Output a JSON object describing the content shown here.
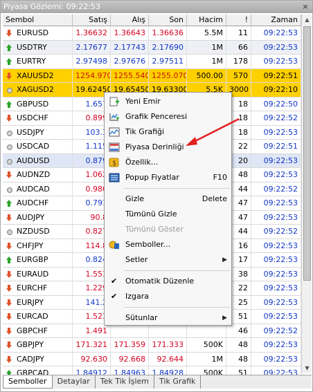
{
  "window": {
    "title": "Piyasa Gözlemi: 09:22:53",
    "close_label": "×"
  },
  "columns": {
    "symbol": "Sembol",
    "bid": "Satış",
    "ask": "Alış",
    "last": "Son",
    "volume": "Hacim",
    "exec": "!",
    "time": "Zaman"
  },
  "rows": [
    {
      "symbol": "EURUSD",
      "dir": "down",
      "bid": "1.36632",
      "ask": "1.36643",
      "last": "1.36636",
      "volume": "5.5M",
      "exec": "11",
      "time": "09:22:53",
      "color": "down",
      "bg": ""
    },
    {
      "symbol": "USDTRY",
      "dir": "up",
      "bid": "2.17677",
      "ask": "2.17743",
      "last": "2.17690",
      "volume": "1M",
      "exec": "66",
      "time": "09:22:53",
      "color": "up",
      "bg": "alt"
    },
    {
      "symbol": "EURTRY",
      "dir": "up",
      "bid": "2.97498",
      "ask": "2.97676",
      "last": "2.97511",
      "volume": "1M",
      "exec": "178",
      "time": "09:22:53",
      "color": "up",
      "bg": ""
    },
    {
      "symbol": "XAUUSD2",
      "dir": "down",
      "bid": "1254.970",
      "ask": "1255.540",
      "last": "1255.070",
      "volume": "500.00",
      "exec": "570",
      "time": "09:22:51",
      "color": "down",
      "bg": "gold"
    },
    {
      "symbol": "XAGUSD2",
      "dir": "dot",
      "bid": "19.62450",
      "ask": "19.65450",
      "last": "19.63300",
      "volume": "5.5K",
      "exec": "3000",
      "time": "09:22:10",
      "color": "none",
      "bg": "gold"
    },
    {
      "symbol": "GBPUSD",
      "dir": "up",
      "bid": "1.657",
      "ask": "",
      "last": "",
      "volume": "",
      "exec": "18",
      "time": "09:22:50",
      "color": "up",
      "bg": ""
    },
    {
      "symbol": "USDCHF",
      "dir": "down",
      "bid": "0.899",
      "ask": "",
      "last": "",
      "volume": "",
      "exec": "18",
      "time": "09:22:52",
      "color": "down",
      "bg": ""
    },
    {
      "symbol": "USDJPY",
      "dir": "dot",
      "bid": "103.3",
      "ask": "",
      "last": "",
      "volume": "",
      "exec": "18",
      "time": "09:22:53",
      "color": "up",
      "bg": ""
    },
    {
      "symbol": "USDCAD",
      "dir": "dot",
      "bid": "1.115",
      "ask": "",
      "last": "",
      "volume": "",
      "exec": "22",
      "time": "09:22:51",
      "color": "up",
      "bg": ""
    },
    {
      "symbol": "AUDUSD",
      "dir": "dot",
      "bid": "0.879",
      "ask": "",
      "last": "",
      "volume": "",
      "exec": "20",
      "time": "09:22:53",
      "color": "up",
      "bg": "sel"
    },
    {
      "symbol": "AUDNZD",
      "dir": "down",
      "bid": "1.062",
      "ask": "",
      "last": "",
      "volume": "",
      "exec": "48",
      "time": "09:22:53",
      "color": "down",
      "bg": ""
    },
    {
      "symbol": "AUDCAD",
      "dir": "dot",
      "bid": "0.980",
      "ask": "",
      "last": "",
      "volume": "",
      "exec": "44",
      "time": "09:22:52",
      "color": "down",
      "bg": ""
    },
    {
      "symbol": "AUDCHF",
      "dir": "up",
      "bid": "0.791",
      "ask": "",
      "last": "",
      "volume": "",
      "exec": "47",
      "time": "09:22:53",
      "color": "up",
      "bg": ""
    },
    {
      "symbol": "AUDJPY",
      "dir": "down",
      "bid": "90.8",
      "ask": "",
      "last": "",
      "volume": "",
      "exec": "47",
      "time": "09:22:53",
      "color": "down",
      "bg": ""
    },
    {
      "symbol": "NZDUSD",
      "dir": "dot",
      "bid": "0.827",
      "ask": "",
      "last": "",
      "volume": "",
      "exec": "44",
      "time": "09:22:52",
      "color": "down",
      "bg": ""
    },
    {
      "symbol": "CHFJPY",
      "dir": "down",
      "bid": "114.8",
      "ask": "",
      "last": "",
      "volume": "",
      "exec": "16",
      "time": "09:22:53",
      "color": "down",
      "bg": ""
    },
    {
      "symbol": "EURGBP",
      "dir": "up",
      "bid": "0.824",
      "ask": "",
      "last": "",
      "volume": "",
      "exec": "17",
      "time": "09:22:53",
      "color": "up",
      "bg": ""
    },
    {
      "symbol": "EURAUD",
      "dir": "down",
      "bid": "1.553",
      "ask": "",
      "last": "",
      "volume": "",
      "exec": "38",
      "time": "09:22:53",
      "color": "down",
      "bg": ""
    },
    {
      "symbol": "EURCHF",
      "dir": "down",
      "bid": "1.229",
      "ask": "",
      "last": "",
      "volume": "",
      "exec": "22",
      "time": "09:22:53",
      "color": "down",
      "bg": ""
    },
    {
      "symbol": "EURJPY",
      "dir": "down",
      "bid": "141.2",
      "ask": "",
      "last": "",
      "volume": "",
      "exec": "25",
      "time": "09:22:53",
      "color": "up",
      "bg": ""
    },
    {
      "symbol": "EURCAD",
      "dir": "down",
      "bid": "1.523",
      "ask": "",
      "last": "",
      "volume": "",
      "exec": "51",
      "time": "09:22:53",
      "color": "down",
      "bg": ""
    },
    {
      "symbol": "GBPCHF",
      "dir": "down",
      "bid": "1.491",
      "ask": "",
      "last": "",
      "volume": "",
      "exec": "46",
      "time": "09:22:52",
      "color": "down",
      "bg": ""
    },
    {
      "symbol": "GBPJPY",
      "dir": "down",
      "bid": "171.321",
      "ask": "171.359",
      "last": "171.333",
      "volume": "500K",
      "exec": "48",
      "time": "09:22:53",
      "color": "down",
      "bg": ""
    },
    {
      "symbol": "CADJPY",
      "dir": "down",
      "bid": "92.630",
      "ask": "92.668",
      "last": "92.644",
      "volume": "1M",
      "exec": "48",
      "time": "09:22:53",
      "color": "down",
      "bg": ""
    },
    {
      "symbol": "GBPCAD",
      "dir": "up",
      "bid": "1.84912",
      "ask": "1.84963",
      "last": "1.84928",
      "volume": "500K",
      "exec": "51",
      "time": "09:22:53",
      "color": "up",
      "bg": ""
    }
  ],
  "context_menu": {
    "new_order": "Yeni Emir",
    "chart_window": "Grafik Penceresi",
    "tick_chart": "Tik Grafiği",
    "depth_of_market": "Piyasa Derinliği",
    "properties": "Özellik...",
    "popup_prices": "Popup Fiyatlar",
    "popup_shortcut": "F10",
    "hide": "Gizle",
    "hide_shortcut": "Delete",
    "hide_all": "Tümünü Gizle",
    "show_all": "Tümünü Göster",
    "symbols": "Semboller...",
    "sets": "Setler",
    "auto_arrange": "Otomatik Düzenle",
    "grid": "Izgara",
    "columns": "Sütunlar",
    "check_mark": "✔",
    "submenu_arrow": "▶"
  },
  "tabs": [
    "Semboller",
    "Detaylar",
    "Tek Tik İşlem",
    "Tik Grafik"
  ],
  "colors": {
    "up": "#1035c8",
    "down": "#d4001f",
    "gold_row": "#ffd000",
    "arrow_annotation": "#e41e1e"
  },
  "icons": {
    "up": "up-arrow-icon",
    "down": "down-arrow-icon",
    "dot": "neutral-dot-icon"
  }
}
